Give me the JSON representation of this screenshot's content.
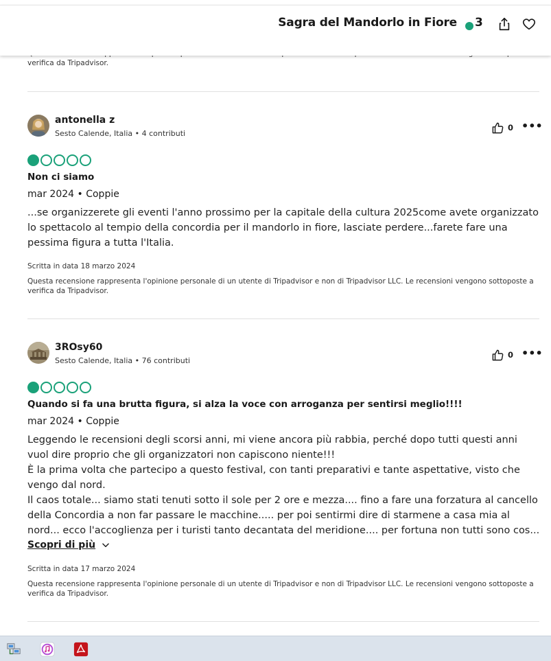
{
  "header": {
    "title": "Sagra del Mandorlo in Fiore",
    "rating_count": "3"
  },
  "overflow_disclaimer": "Questa recensione rappresenta l'opinione personale di un utente di Tripadvisor e non di Tripadvisor LLC. Le recensioni vengono sottoposte a verifica da Tripadvisor.",
  "reviews": [
    {
      "user": "antonella z",
      "meta": "Sesto Calende, Italia • 4 contributi",
      "helpful_count": "0",
      "rating": 1,
      "title": "Non ci siamo",
      "date_trip": "mar 2024 • Coppie",
      "body": [
        "...se organizzerete gli eventi l'anno prossimo per la capitale della cultura 2025come avete organizzato",
        "lo spettacolo al tempio della concordia per il mandorlo in fiore, lasciate perdere...farete fare una",
        "pessima figura a tutta l'Italia."
      ],
      "written": "Scritta in data 18 marzo 2024",
      "disclaimer": "Questa recensione rappresenta l'opinione personale di un utente di Tripadvisor e non di Tripadvisor LLC. Le recensioni vengono sottoposte a verifica da Tripadvisor."
    },
    {
      "user": "3ROsy60",
      "meta": "Sesto Calende, Italia • 76 contributi",
      "helpful_count": "0",
      "rating": 1,
      "title": "Quando si fa una brutta figura, si alza la voce con arroganza per sentirsi meglio!!!!",
      "date_trip": "mar 2024 • Coppie",
      "body": [
        "Leggendo le recensioni degli scorsi anni, mi viene ancora più rabbia, perché dopo tutti questi anni",
        "vuol dire proprio che gli organizzatori non capiscono niente!!!",
        "È la prima volta che partecipo a questo festival, con tanti preparativi e tante aspettative, visto che",
        "vengo dal nord.",
        "Il caos totale... siamo stati tenuti sotto il sole per 2 ore e mezza.... fino a fare una forzatura al cancello",
        "della Concordia a non far passare le macchine..... per poi sentirmi dire di starmene a casa mia al",
        "nord... ecco l'accoglienza per i turisti tanto decantata del meridione.... per fortuna non tutti sono cos..."
      ],
      "read_more": "Scopri di più",
      "written": "Scritta in data 17 marzo 2024",
      "disclaimer": "Questa recensione rappresenta l'opinione personale di un utente di Tripadvisor e non di Tripadvisor LLC. Le recensioni vengono sottoposte a verifica da Tripadvisor."
    }
  ],
  "colors": {
    "accent": "#1aa179",
    "taskbar": "#dbe3ec"
  },
  "icons": [
    "share-icon",
    "heart-icon",
    "thumbs-up-icon",
    "more-icon",
    "chevron-down-icon",
    "network-icon",
    "itunes-icon",
    "acrobat-icon"
  ]
}
